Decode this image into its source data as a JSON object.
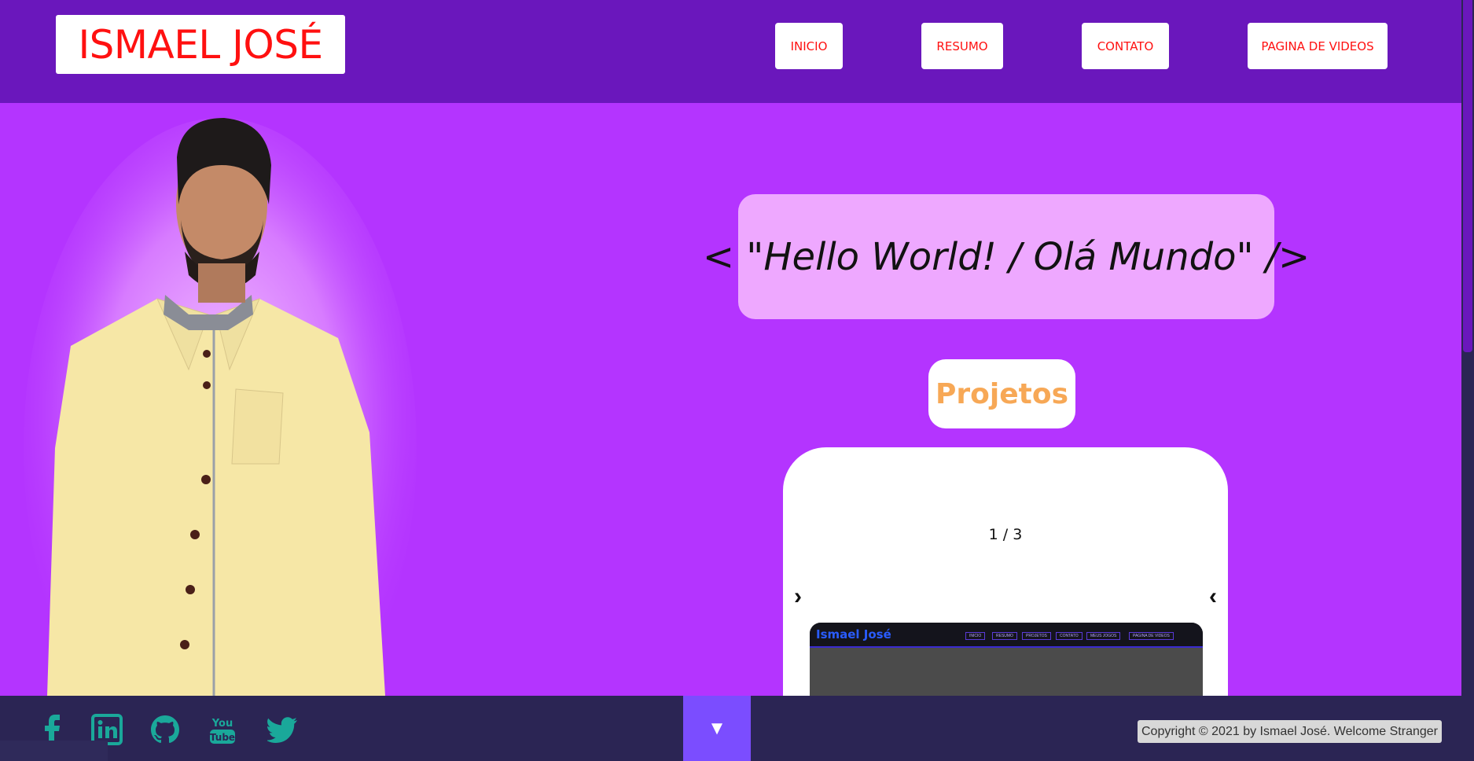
{
  "header": {
    "brand": "ISMAEL JOSÉ",
    "nav": [
      "INICIO",
      "RESUMO",
      "CONTATO",
      "PAGINA DE VIDEOS"
    ]
  },
  "hero": {
    "greeting": "< \"Hello World! / Olá Mundo\" />",
    "photo_icon": "person-portrait"
  },
  "projects": {
    "heading": "Projetos",
    "counter": "1 / 3",
    "prev_arrow": "›",
    "next_arrow": "‹",
    "slide": {
      "site_logo": "Ismael José",
      "site_nav": [
        "INICIO",
        "RESUMO",
        "PROJETOS",
        "CONTATO",
        "MEUS JOGOS",
        "PAGINA DE VIDEOS"
      ]
    }
  },
  "footer": {
    "social_icons": [
      "facebook-icon",
      "linkedin-icon",
      "github-icon",
      "youtube-icon",
      "twitter-icon"
    ],
    "scroll_down": "▼",
    "copyright": "Copyright © 2021 by Ismael José. Welcome Stranger"
  },
  "colors": {
    "header_bg": "#6a17bc",
    "page_bg": "#b434ff",
    "brand_red": "#ff1010",
    "social_teal": "#1aa89a",
    "footer_bg": "#2b2554",
    "projects_orange": "#f7a856"
  }
}
